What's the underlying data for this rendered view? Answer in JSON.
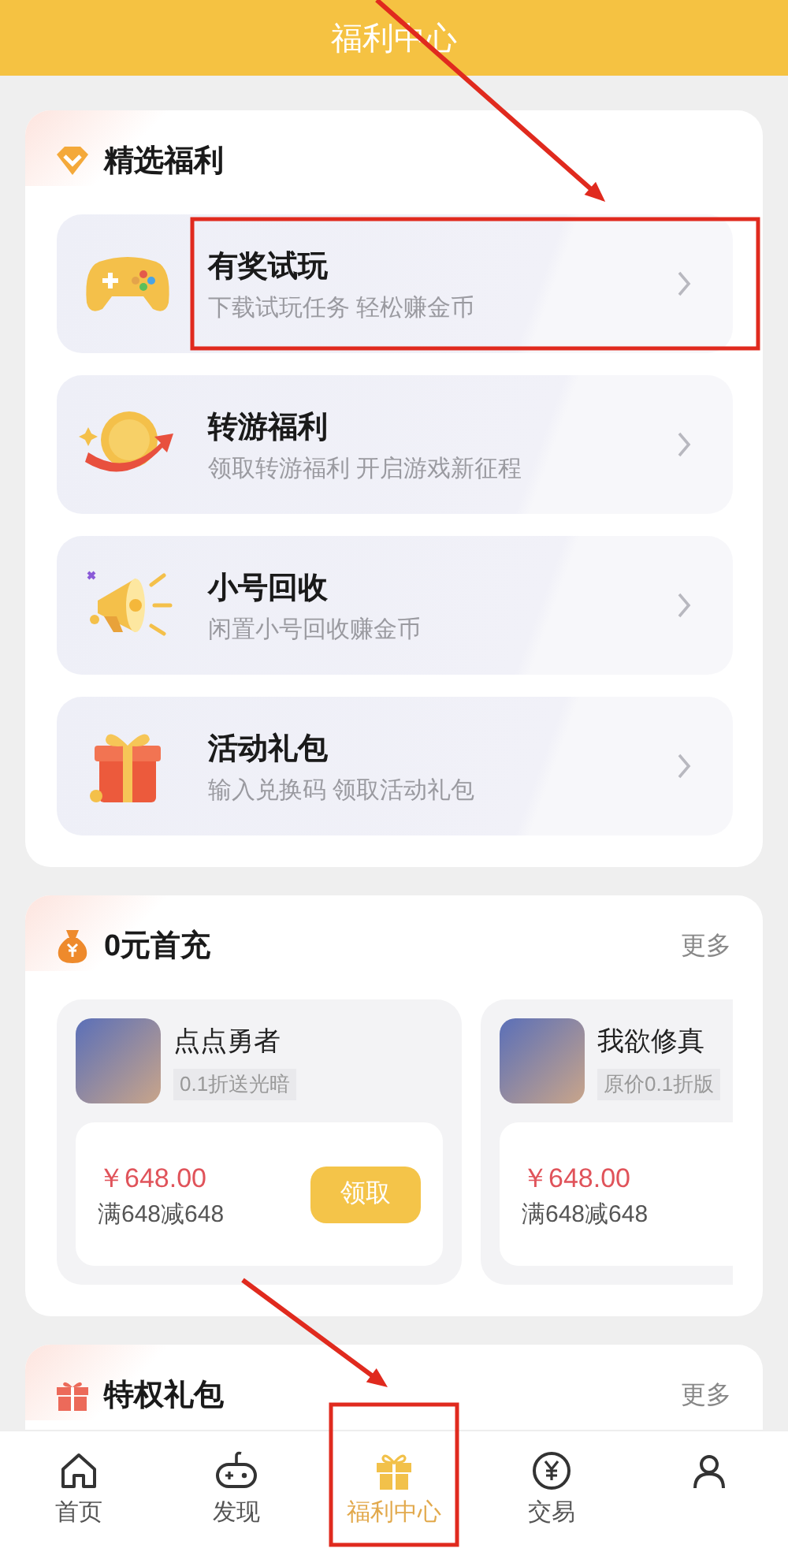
{
  "header": {
    "title": "福利中心"
  },
  "featured": {
    "title": "精选福利",
    "items": [
      {
        "kind": "gamepad",
        "title": "有奖试玩",
        "subtitle": "下载试玩任务 轻松赚金币",
        "highlighted": true
      },
      {
        "kind": "coin",
        "title": "转游福利",
        "subtitle": "领取转游福利 开启游戏新征程",
        "highlighted": false
      },
      {
        "kind": "megaphone",
        "title": "小号回收",
        "subtitle": "闲置小号回收赚金币",
        "highlighted": false
      },
      {
        "kind": "gift",
        "title": "活动礼包",
        "subtitle": "输入兑换码 领取活动礼包",
        "highlighted": false
      }
    ]
  },
  "recharge": {
    "title": "0元首充",
    "more": "更多",
    "games": [
      {
        "name": "点点勇者",
        "tag": "0.1折送光暗",
        "price": "￥648.00",
        "condition": "满648减648",
        "button": "领取"
      },
      {
        "name": "我欲修真",
        "tag": "原价0.1折版",
        "price": "￥648.00",
        "condition": "满648减648"
      }
    ]
  },
  "privileges": {
    "title": "特权礼包",
    "more": "更多"
  },
  "nav": [
    {
      "kind": "home",
      "label": "首页",
      "selected": false,
      "highlighted": false
    },
    {
      "kind": "gamepad",
      "label": "发现",
      "selected": false,
      "highlighted": false
    },
    {
      "kind": "gift",
      "label": "福利中心",
      "selected": true,
      "highlighted": true
    },
    {
      "kind": "yen",
      "label": "交易",
      "selected": false,
      "highlighted": false
    },
    {
      "kind": "person",
      "selected": false,
      "highlighted": false
    }
  ]
}
